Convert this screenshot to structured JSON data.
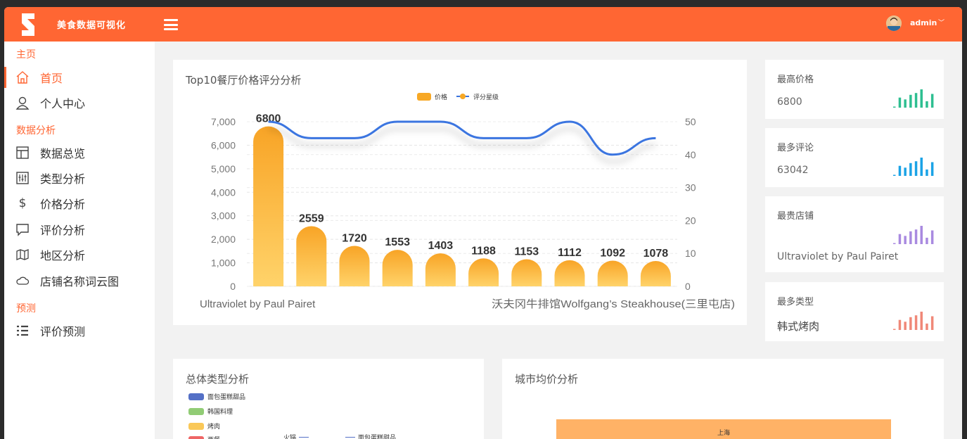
{
  "header": {
    "app_title": "美食数据可视化",
    "user": "admin",
    "user_caret": "﹀",
    "brand_color": "#ff6633"
  },
  "sidebar": {
    "sections": [
      {
        "title": "主页",
        "items": [
          {
            "label": "首页",
            "icon": "home-icon",
            "active": true
          },
          {
            "label": "个人中心",
            "icon": "user-icon"
          }
        ]
      },
      {
        "title": "数据分析",
        "items": [
          {
            "label": "数据总览",
            "icon": "layout-icon"
          },
          {
            "label": "类型分析",
            "icon": "sliders-icon"
          },
          {
            "label": "价格分析",
            "icon": "dollar-icon"
          },
          {
            "label": "评价分析",
            "icon": "comment-icon"
          },
          {
            "label": "地区分析",
            "icon": "map-icon"
          },
          {
            "label": "店铺名称词云图",
            "icon": "cloud-icon"
          }
        ]
      },
      {
        "title": "预测",
        "items": [
          {
            "label": "评价预测",
            "icon": "list-icon"
          }
        ]
      }
    ]
  },
  "main_chart": {
    "title": "Top10餐厅价格评分分析",
    "chart_data": {
      "type": "bar",
      "legend": [
        "价格",
        "评分星级"
      ],
      "legend_position": "top-center",
      "x_tick_labels": [
        "Ultraviolet by Paul Pairet",
        "沃夫冈牛排馆Wolfgang’s Steakhouse(三里屯店)"
      ],
      "series": [
        {
          "name": "价格",
          "type": "bar",
          "values": [
            6800,
            2559,
            1720,
            1553,
            1403,
            1188,
            1153,
            1112,
            1092,
            1078
          ],
          "color": "#f7a825"
        },
        {
          "name": "评分星级",
          "type": "line",
          "values": [
            50,
            45,
            45,
            50,
            50,
            45,
            45,
            50,
            40,
            45
          ],
          "color": "#3a74e0"
        }
      ],
      "y_left": {
        "ticks": [
          "0",
          "1,000",
          "2,000",
          "3,000",
          "4,000",
          "5,000",
          "6,000",
          "7,000"
        ],
        "range": [
          0,
          7000
        ]
      },
      "y_right": {
        "ticks": [
          "0",
          "10",
          "20",
          "30",
          "40",
          "50"
        ],
        "range": [
          0,
          50
        ]
      },
      "grid": true
    }
  },
  "stats": [
    {
      "title": "最高价格",
      "value": "6800",
      "color": "#2ebf91",
      "bars": [
        0.05,
        0.55,
        0.45,
        0.7,
        0.8,
        1.0,
        0.35,
        0.75
      ]
    },
    {
      "title": "最多评论",
      "value": "63042",
      "color": "#1ba3e6",
      "bars": [
        0.05,
        0.55,
        0.45,
        0.7,
        0.8,
        1.0,
        0.35,
        0.75
      ]
    },
    {
      "title": "最贵店铺",
      "value": "Ultraviolet by Paul Pairet",
      "color": "#a98ae0",
      "bars": [
        0.05,
        0.55,
        0.45,
        0.7,
        0.8,
        1.0,
        0.35,
        0.75
      ]
    },
    {
      "title": "最多类型",
      "value": "韩式烤肉",
      "color": "#f08878",
      "bars": [
        0.05,
        0.55,
        0.45,
        0.7,
        0.8,
        1.0,
        0.35,
        0.75
      ]
    }
  ],
  "type_chart": {
    "title": "总体类型分析",
    "legend": [
      {
        "label": "面包蛋糕甜品",
        "color": "#5470c6"
      },
      {
        "label": "韩国料理",
        "color": "#91cc75"
      },
      {
        "label": "烤肉",
        "color": "#fac858"
      },
      {
        "label": "西餐",
        "color": "#ee6666"
      }
    ],
    "labels": [
      "火锅",
      "面包蛋糕甜品"
    ]
  },
  "city_chart": {
    "title": "城市均价分析",
    "bar_label": "上海",
    "bar_color": "#ffb266"
  }
}
